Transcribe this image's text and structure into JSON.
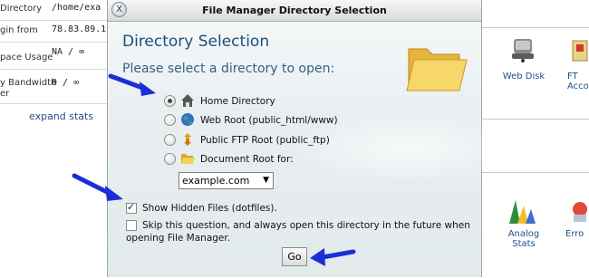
{
  "background": {
    "rows": [
      {
        "label": "Directory",
        "value": "/home/exa"
      },
      {
        "label": "gin from",
        "value": "78.83.89.1"
      },
      {
        "label": "pace Usage",
        "value": "NA / ∞"
      },
      {
        "label": "y Bandwidth",
        "label2": "er",
        "value": "0 / ∞"
      }
    ],
    "expand_stats": "expand stats",
    "right_icons": [
      {
        "label": "Web Disk"
      },
      {
        "label": "FT",
        "label2": "Acco"
      },
      {
        "label": "Analog",
        "label2": "Stats"
      },
      {
        "label": "Erro"
      }
    ]
  },
  "dialog": {
    "window_title": "File Manager Directory Selection",
    "close_label": "X",
    "heading": "Directory Selection",
    "prompt": "Please select a directory to open:",
    "options": [
      {
        "label": "Home Directory",
        "icon": "home-icon",
        "selected": true
      },
      {
        "label": "Web Root (public_html/www)",
        "icon": "globe-icon",
        "selected": false
      },
      {
        "label": "Public FTP Root (public_ftp)",
        "icon": "ftp-icon",
        "selected": false
      },
      {
        "label": "Document Root for:",
        "icon": "folder-open-icon",
        "selected": false
      }
    ],
    "domain_select": {
      "value": "example.com"
    },
    "show_hidden": {
      "label": "Show Hidden Files (dotfiles).",
      "checked": true
    },
    "skip_question": {
      "label_line1": "Skip this question, and always open this directory in the future when",
      "label_line2": "opening File Manager.",
      "checked": false
    },
    "go_label": "Go"
  },
  "colors": {
    "heading": "#1f4d78",
    "annotation_arrow": "#1a2fd6"
  }
}
